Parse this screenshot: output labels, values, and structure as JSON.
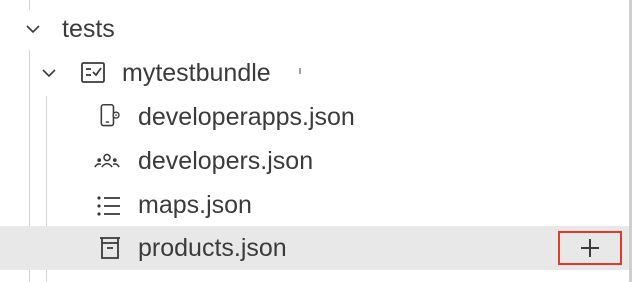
{
  "tree": {
    "tests": {
      "label": "tests",
      "expanded": true,
      "icon": "chevron-down-icon"
    },
    "bundle": {
      "label": "mytestbundle",
      "expanded": true,
      "icon": "checklist-icon"
    },
    "files": [
      {
        "label": "developerapps.json",
        "icon": "mobile-gear-icon"
      },
      {
        "label": "developers.json",
        "icon": "people-icon"
      },
      {
        "label": "maps.json",
        "icon": "list-icon"
      },
      {
        "label": "products.json",
        "icon": "package-icon",
        "selected": true
      }
    ],
    "actions": {
      "add_icon": "plus-icon"
    }
  },
  "colors": {
    "text": "#3b3b3b",
    "selected_row": "#e8e8e8",
    "highlight_border": "#e03b24",
    "guide": "#d4d4d4"
  }
}
